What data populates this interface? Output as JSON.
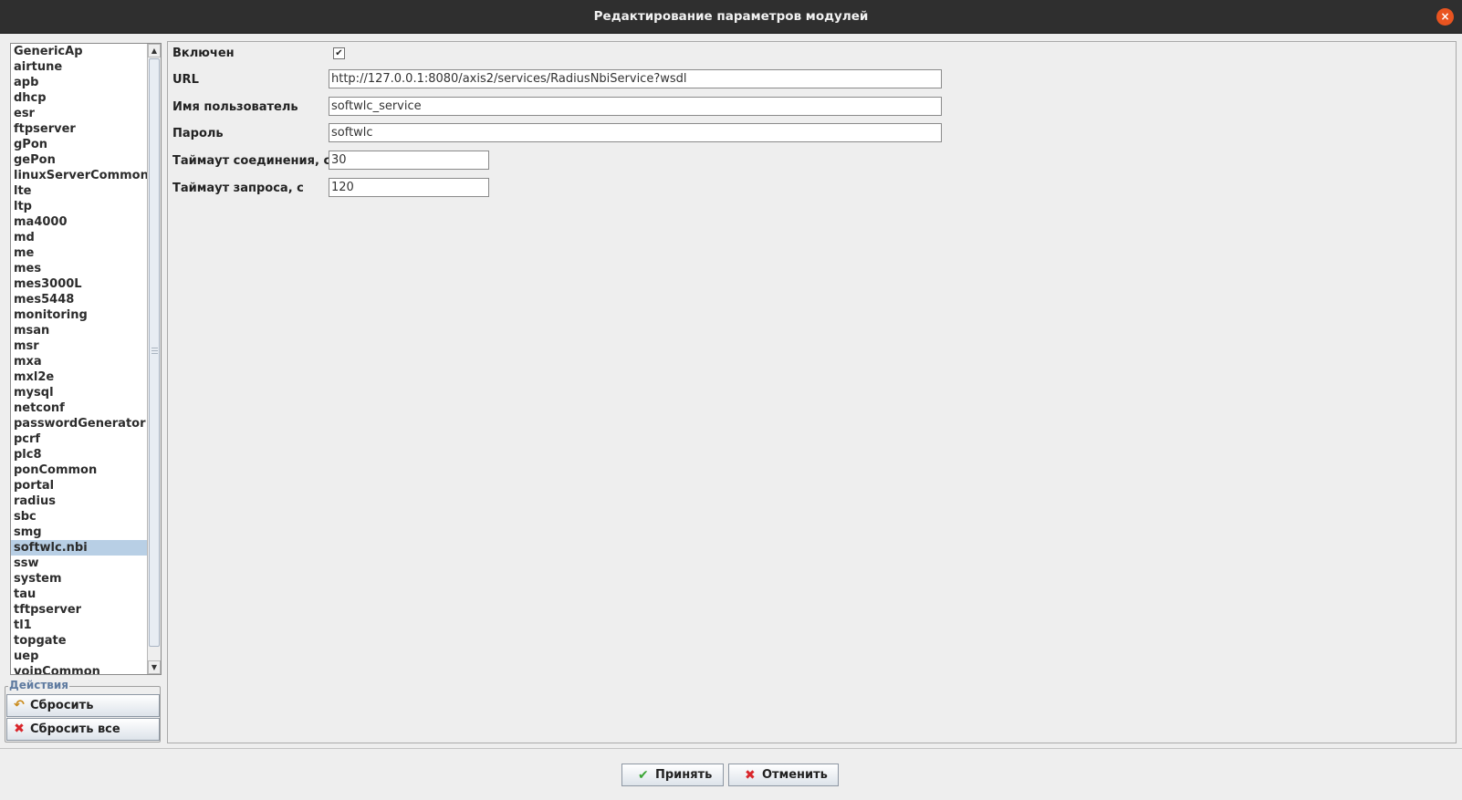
{
  "window": {
    "title": "Редактирование параметров модулей"
  },
  "modules": {
    "items": [
      "GenericAp",
      "airtune",
      "apb",
      "dhcp",
      "esr",
      "ftpserver",
      "gPon",
      "gePon",
      "linuxServerCommon",
      "lte",
      "ltp",
      "ma4000",
      "md",
      "me",
      "mes",
      "mes3000L",
      "mes5448",
      "monitoring",
      "msan",
      "msr",
      "mxa",
      "mxl2e",
      "mysql",
      "netconf",
      "passwordGenerator",
      "pcrf",
      "plc8",
      "ponCommon",
      "portal",
      "radius",
      "sbc",
      "smg",
      "softwlc.nbi",
      "ssw",
      "system",
      "tau",
      "tftpserver",
      "tl1",
      "topgate",
      "uep",
      "voipCommon"
    ],
    "selected": "softwlc.nbi"
  },
  "actions": {
    "title": "Действия",
    "reset_label": "Сбросить",
    "reset_all_label": "Сбросить все"
  },
  "params": {
    "enabled_label": "Включен",
    "enabled_mark": "✔",
    "url_label": "URL",
    "url_value": "http://127.0.0.1:8080/axis2/services/RadiusNbiService?wsdl",
    "user_label": "Имя пользователь",
    "user_value": "softwlc_service",
    "password_label": "Пароль",
    "password_value": "softwlc",
    "conn_timeout_label": "Таймаут соединения, с",
    "conn_timeout_value": "30",
    "req_timeout_label": "Таймаут запроса, с",
    "req_timeout_value": "120"
  },
  "buttons": {
    "ok_label": "Принять",
    "cancel_label": "Отменить"
  },
  "icons": {
    "close": "close-icon",
    "undo": "undo-icon",
    "red_x": "cross-icon",
    "check": "check-icon"
  },
  "colors": {
    "titlebar": "#2f2f2f",
    "close_button": "#e95420",
    "selection": "#b8cfe5",
    "legend": "#5f7ba0",
    "check_green": "#3aa535",
    "cross_red": "#d9262b"
  }
}
